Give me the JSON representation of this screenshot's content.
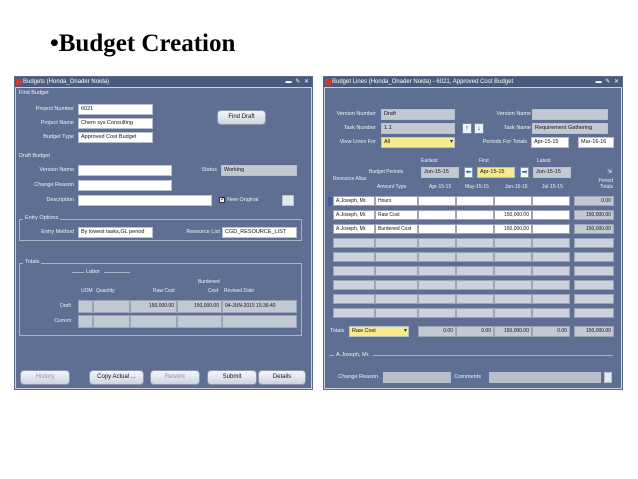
{
  "slide": {
    "title": "•Budget Creation"
  },
  "budgets_window": {
    "title": "Budgets (Honda_Onader Noida)",
    "find_budget": {
      "section": "Find Budget",
      "project_number_label": "Project Number",
      "project_number": "6021",
      "project_name_label": "Project Name",
      "project_name": "Chem sys Consulting",
      "budget_type_label": "Budget Type",
      "budget_type": "Approved Cost Budget",
      "find_draft_button": "Find Draft"
    },
    "draft_budget": {
      "section": "Draft Budget",
      "version_name_label": "Version Name",
      "version_name": "",
      "status_label": "Status",
      "status": "Working",
      "change_reason_label": "Change Reason",
      "change_reason": "",
      "description_label": "Description",
      "description": "",
      "new_original_label": "New Original",
      "new_original_checked": true
    },
    "entry_options": {
      "section": "Entry Options",
      "entry_method_label": "Entry Method",
      "entry_method": "By lowest tasks,GL period",
      "resource_list_label": "Resource List",
      "resource_list": "CGD_RESOURCE_LIST"
    },
    "totals": {
      "section": "Totals",
      "labor_label": "Labor",
      "burdened_label": "Burdened",
      "columns": [
        "UOM",
        "Quantity",
        "Raw Cost",
        "Cost",
        "Revised Date"
      ],
      "rows": [
        {
          "label": "Draft",
          "uom": "",
          "quantity": "",
          "raw_cost": "150,000.00",
          "cost": "150,000.00",
          "revised_date": "04-JUN-2015 15:36:40"
        },
        {
          "label": "Current",
          "uom": "",
          "quantity": "",
          "raw_cost": "",
          "cost": "",
          "revised_date": ""
        }
      ]
    },
    "buttons": {
      "history": "History",
      "copy_actual": "Copy Actual ...",
      "rework": "Rework",
      "submit": "Submit",
      "details": "Details"
    }
  },
  "budget_lines_window": {
    "title": "Budget Lines (Honda_Onader Noida) - 6021, Approved Cost Budget",
    "version_number_label": "Version Number",
    "version_number": "Draft",
    "version_name_label": "Version Name",
    "version_name": "",
    "task_number_label": "Task Number",
    "task_number": "1.1",
    "task_name_label": "Task Name",
    "task_name": "Requirement Gathering",
    "view_lines_for_label": "View Lines For",
    "view_lines_for": "All",
    "periods_for_totals_label": "Periods For Totals",
    "periods_from": "Apr-15-15",
    "periods_to": "Mar-16-16",
    "earliest_label": "Earliest",
    "first_label": "First",
    "latest_label": "Latest",
    "budget_periods_label": "Budget Periods",
    "earliest": "Jun-15-15",
    "first": "Apr-15-15",
    "latest": "Jun-15-15",
    "resource_alias_label": "Resource Alias",
    "amount_type_label": "Amount Type",
    "period_headers": [
      "Apr-15-15",
      "May-15-15",
      "Jun-15-15",
      "Jul-15-15"
    ],
    "period_totals_label": "Period Totals",
    "rows": [
      {
        "resource": "A.Joseph, Mr.",
        "amount_type": "Hours",
        "apr": "",
        "may": "",
        "jun": "",
        "jul": "",
        "total": "0.00"
      },
      {
        "resource": "A.Joseph, Mr.",
        "amount_type": "Raw Cost",
        "apr": "",
        "may": "",
        "jun": "150,000.00",
        "jul": "",
        "total": "150,000.00"
      },
      {
        "resource": "A.Joseph, Mr.",
        "amount_type": "Burdened Cost",
        "apr": "",
        "may": "",
        "jun": "150,000.00",
        "jul": "",
        "total": "150,000.00"
      }
    ],
    "totals_label": "Totals",
    "totals_type": "Raw Cost",
    "totals_values": [
      "0.00",
      "0.00",
      "150,000.00",
      "0.00",
      "150,000.00"
    ],
    "footer_resource": "A.Joseph, Mr.",
    "change_reason_label": "Change Reason",
    "comments_label": "Comments"
  }
}
